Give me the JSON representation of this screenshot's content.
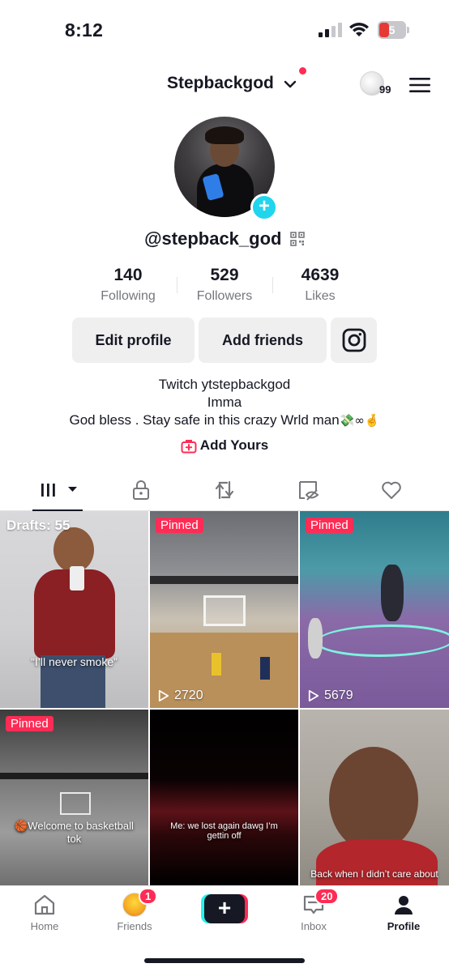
{
  "status_bar": {
    "time": "8:12",
    "battery": "5"
  },
  "header": {
    "username": "Stepbackgod",
    "points": "99"
  },
  "profile": {
    "handle": "@stepback_god",
    "stats": [
      {
        "value": "140",
        "label": "Following"
      },
      {
        "value": "529",
        "label": "Followers"
      },
      {
        "value": "4639",
        "label": "Likes"
      }
    ],
    "buttons": {
      "edit": "Edit profile",
      "add_friends": "Add friends"
    },
    "bio": {
      "line1": "Twitch ytstepbackgod",
      "line2": "Imma",
      "line3": "God bless . Stay safe in this crazy Wrld man",
      "line3_emoji": "💸∞🤞"
    },
    "add_yours": "Add Yours"
  },
  "grid": [
    {
      "badge": "Drafts: 55",
      "caption": "“I’ll never smoke”"
    },
    {
      "badge": "Pinned",
      "views": "2720"
    },
    {
      "badge": "Pinned",
      "views": "5679"
    },
    {
      "badge": "Pinned",
      "caption": "🏀Welcome to basketball tok"
    },
    {
      "caption": "Me: we lost again dawg I’m gettin off"
    },
    {
      "caption": "Back when I didn’t care about"
    }
  ],
  "bottom_nav": {
    "home": "Home",
    "friends": "Friends",
    "friends_badge": "1",
    "inbox": "Inbox",
    "inbox_badge": "20",
    "profile": "Profile"
  }
}
